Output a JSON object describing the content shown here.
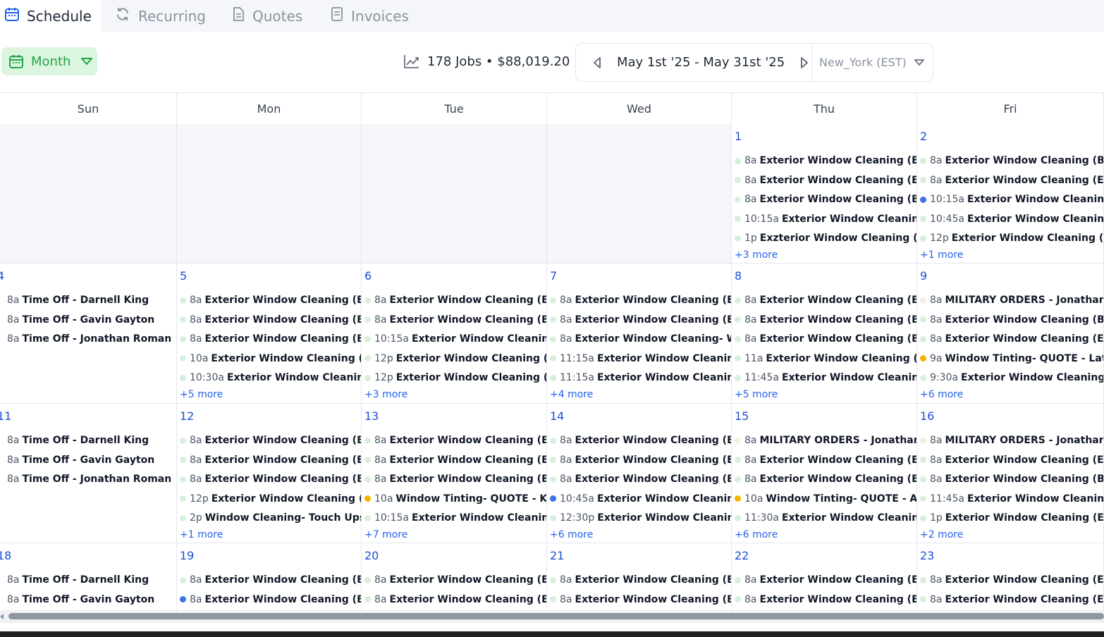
{
  "tabs": [
    {
      "label": "Schedule",
      "icon": "calendar-icon",
      "active": true
    },
    {
      "label": "Recurring",
      "icon": "refresh-icon",
      "active": false
    },
    {
      "label": "Quotes",
      "icon": "document-icon",
      "active": false
    },
    {
      "label": "Invoices",
      "icon": "invoice-icon",
      "active": false
    }
  ],
  "toolbar": {
    "view_label": "Month",
    "stats_text": "178 Jobs • $88,019.20",
    "date_range": "May 1st '25 - May 31st '25",
    "timezone": "New_York (EST)"
  },
  "colors": {
    "accent_green": "#22a447",
    "link_blue": "#2563eb",
    "dot_green": "#d7f0dc",
    "dot_blue": "#3b73e8",
    "dot_orange": "#f2b400",
    "dot_pale": "#f6efe0"
  },
  "weekdays": [
    "Sun",
    "Mon",
    "Tue",
    "Wed",
    "Thu",
    "Fri"
  ],
  "weeks": [
    [
      {
        "empty": true
      },
      {
        "empty": true
      },
      {
        "empty": true
      },
      {
        "empty": true
      },
      {
        "day": "1",
        "events": [
          {
            "time": "8a",
            "title": "Exterior Window Cleaning (ELITE",
            "dot": "green"
          },
          {
            "time": "8a",
            "title": "Exterior Window Cleaning (ELITE",
            "dot": "green"
          },
          {
            "time": "8a",
            "title": "Exterior Window Cleaning (BASIC",
            "dot": "green"
          },
          {
            "time": "10:15a",
            "title": "Exterior Window Cleaning (",
            "dot": "green"
          },
          {
            "time": "1p",
            "title": "Exzterior Window Cleaning (ELITE",
            "dot": "green"
          }
        ],
        "more": "+3 more"
      },
      {
        "day": "2",
        "events": [
          {
            "time": "8a",
            "title": "Exterior Window Cleaning (BASIC",
            "dot": "green"
          },
          {
            "time": "8a",
            "title": "Exterior Window Cleaning (ELITE",
            "dot": "green"
          },
          {
            "time": "10:15a",
            "title": "Exterior Window Cleaning (",
            "dot": "blue"
          },
          {
            "time": "10:45a",
            "title": "Exterior Window Cleaning (",
            "dot": "green"
          },
          {
            "time": "12p",
            "title": "Exterior Window Cleaning (ELITE",
            "dot": "green"
          }
        ],
        "more": "+1 more"
      }
    ],
    [
      {
        "day": "4",
        "events": [
          {
            "time": "8a",
            "title": "Time Off - Darnell King",
            "dot": "none"
          },
          {
            "time": "8a",
            "title": "Time Off - Gavin Gayton",
            "dot": "none"
          },
          {
            "time": "8a",
            "title": "Time Off - Jonathan Roman",
            "dot": "none"
          }
        ]
      },
      {
        "day": "5",
        "events": [
          {
            "time": "8a",
            "title": "Exterior Window Cleaning (ELITE",
            "dot": "green"
          },
          {
            "time": "8a",
            "title": "Exterior Window Cleaning (ELITE",
            "dot": "green"
          },
          {
            "time": "8a",
            "title": "Exterior Window Cleaning (BASIC",
            "dot": "green"
          },
          {
            "time": "10a",
            "title": "Exterior Window Cleaning (ELITE",
            "dot": "green"
          },
          {
            "time": "10:30a",
            "title": "Exterior Window Cleaning (",
            "dot": "green"
          }
        ],
        "more": "+5 more"
      },
      {
        "day": "6",
        "events": [
          {
            "time": "8a",
            "title": "Exterior Window Cleaning (ELITE",
            "dot": "green"
          },
          {
            "time": "8a",
            "title": "Exterior Window Cleaning (BASIC",
            "dot": "green"
          },
          {
            "time": "10:15a",
            "title": "Exterior Window Cleaning (",
            "dot": "green"
          },
          {
            "time": "12p",
            "title": "Exterior Window Cleaning (ELITE",
            "dot": "green"
          },
          {
            "time": "12p",
            "title": "Exterior Window Cleaning (ELITE",
            "dot": "green"
          }
        ],
        "more": "+3 more"
      },
      {
        "day": "7",
        "events": [
          {
            "time": "8a",
            "title": "Exterior Window Cleaning (ELITE",
            "dot": "green"
          },
          {
            "time": "8a",
            "title": "Exterior Window Cleaning (ELITE",
            "dot": "green"
          },
          {
            "time": "8a",
            "title": "Exterior Window Cleaning- Wa",
            "dot": "green"
          },
          {
            "time": "11:15a",
            "title": "Exterior Window Cleaning (I",
            "dot": "green"
          },
          {
            "time": "11:15a",
            "title": "Exterior Window Cleaning (I",
            "dot": "green"
          }
        ],
        "more": "+4 more"
      },
      {
        "day": "8",
        "events": [
          {
            "time": "8a",
            "title": "Exterior Window Cleaning (ELITE",
            "dot": "green"
          },
          {
            "time": "8a",
            "title": "Exterior Window Cleaning (BASIC",
            "dot": "green"
          },
          {
            "time": "8a",
            "title": "Exterior Window Cleaning (BASIC",
            "dot": "green"
          },
          {
            "time": "11a",
            "title": "Exterior Window Cleaning (BASIC",
            "dot": "green"
          },
          {
            "time": "11:45a",
            "title": "Exterior Window Cleaning (",
            "dot": "green"
          }
        ],
        "more": "+5 more"
      },
      {
        "day": "9",
        "events": [
          {
            "time": "8a",
            "title": "MILITARY ORDERS - Jonathan",
            "dot": "pale"
          },
          {
            "time": "8a",
            "title": "Exterior Window Cleaning (BASIC",
            "dot": "green"
          },
          {
            "time": "8a",
            "title": "Exterior Window Cleaning (ELITE",
            "dot": "green"
          },
          {
            "time": "9a",
            "title": "Window Tinting- QUOTE - Latoya",
            "dot": "orange"
          },
          {
            "time": "9:30a",
            "title": "Exterior Window Cleaning (I",
            "dot": "green"
          }
        ],
        "more": "+6 more"
      }
    ],
    [
      {
        "day": "11",
        "events": [
          {
            "time": "8a",
            "title": "Time Off - Darnell King",
            "dot": "none"
          },
          {
            "time": "8a",
            "title": "Time Off - Gavin Gayton",
            "dot": "none"
          },
          {
            "time": "8a",
            "title": "Time Off - Jonathan Roman",
            "dot": "none"
          }
        ]
      },
      {
        "day": "12",
        "events": [
          {
            "time": "8a",
            "title": "Exterior Window Cleaning (ELITE",
            "dot": "green"
          },
          {
            "time": "8a",
            "title": "Exterior Window Cleaning (ELITE",
            "dot": "green"
          },
          {
            "time": "8a",
            "title": "Exterior Window Cleaning (ELITE",
            "dot": "green"
          },
          {
            "time": "12p",
            "title": "Exterior Window Cleaning (ELITE",
            "dot": "green"
          },
          {
            "time": "2p",
            "title": "Window Cleaning- Touch Ups - ",
            "dot": "green"
          }
        ],
        "more": "+1 more"
      },
      {
        "day": "13",
        "events": [
          {
            "time": "8a",
            "title": "Exterior Window Cleaning (ELITE",
            "dot": "green"
          },
          {
            "time": "8a",
            "title": "Exterior Window Cleaning (ELITE",
            "dot": "green"
          },
          {
            "time": "8a",
            "title": "Exterior Window Cleaning (BASIC",
            "dot": "green"
          },
          {
            "time": "10a",
            "title": "Window Tinting- QUOTE - Kelly",
            "dot": "orange"
          },
          {
            "time": "10:15a",
            "title": "Exterior Window Cleaning (",
            "dot": "green"
          }
        ],
        "more": "+7 more"
      },
      {
        "day": "14",
        "events": [
          {
            "time": "8a",
            "title": "Exterior Window Cleaning (ELITE",
            "dot": "green"
          },
          {
            "time": "8a",
            "title": "Exterior Window Cleaning (ELITE",
            "dot": "green"
          },
          {
            "time": "8a",
            "title": "Exterior Window Cleaning (BASIC",
            "dot": "green"
          },
          {
            "time": "10:45a",
            "title": "Exterior Window Cleaning (",
            "dot": "blue"
          },
          {
            "time": "12:30p",
            "title": "Exterior Window Cleaning (",
            "dot": "green"
          }
        ],
        "more": "+6 more"
      },
      {
        "day": "15",
        "events": [
          {
            "time": "8a",
            "title": "MILITARY ORDERS - Jonathan",
            "dot": "pale"
          },
          {
            "time": "8a",
            "title": "Exterior Window Cleaning (ELITE",
            "dot": "green"
          },
          {
            "time": "8a",
            "title": "Exterior Window Cleaning (ELITE",
            "dot": "green"
          },
          {
            "time": "10a",
            "title": "Window Tinting- QUOTE - Andrea",
            "dot": "orange"
          },
          {
            "time": "11:30a",
            "title": "Exterior Window Cleaning (",
            "dot": "green"
          }
        ],
        "more": "+6 more"
      },
      {
        "day": "16",
        "events": [
          {
            "time": "8a",
            "title": "MILITARY ORDERS - Jonathan",
            "dot": "pale"
          },
          {
            "time": "8a",
            "title": "Exterior Window Cleaning (ELITE",
            "dot": "green"
          },
          {
            "time": "8a",
            "title": "Exterior Window Cleaning (BASIC",
            "dot": "green"
          },
          {
            "time": "11:45a",
            "title": "Exterior Window Cleaning (",
            "dot": "green"
          },
          {
            "time": "1p",
            "title": "Exterior Window Cleaning (ELITE",
            "dot": "green"
          }
        ],
        "more": "+2 more"
      }
    ],
    [
      {
        "day": "18",
        "events": [
          {
            "time": "8a",
            "title": "Time Off - Darnell King",
            "dot": "none"
          },
          {
            "time": "8a",
            "title": "Time Off - Gavin Gayton",
            "dot": "none"
          }
        ]
      },
      {
        "day": "19",
        "events": [
          {
            "time": "8a",
            "title": "Exterior Window Cleaning (ELITE",
            "dot": "green"
          },
          {
            "time": "8a",
            "title": "Exterior Window Cleaning (ELITE",
            "dot": "blue"
          }
        ]
      },
      {
        "day": "20",
        "events": [
          {
            "time": "8a",
            "title": "Exterior Window Cleaning (ELITE",
            "dot": "green"
          },
          {
            "time": "8a",
            "title": "Exterior Window Cleaning (ELITE",
            "dot": "green"
          }
        ]
      },
      {
        "day": "21",
        "events": [
          {
            "time": "8a",
            "title": "Exterior Window Cleaning (ELITE",
            "dot": "green"
          },
          {
            "time": "8a",
            "title": "Exterior Window Cleaning (BASIC",
            "dot": "green"
          }
        ]
      },
      {
        "day": "22",
        "events": [
          {
            "time": "8a",
            "title": "Exterior Window Cleaning (ELITE",
            "dot": "green"
          },
          {
            "time": "8a",
            "title": "Exterior Window Cleaning (ELITE",
            "dot": "green"
          }
        ]
      },
      {
        "day": "23",
        "events": [
          {
            "time": "8a",
            "title": "Exterior Window Cleaning (ELITE",
            "dot": "green"
          },
          {
            "time": "8a",
            "title": "Exterior Window Cleaning (ELITE",
            "dot": "green"
          }
        ]
      }
    ]
  ]
}
